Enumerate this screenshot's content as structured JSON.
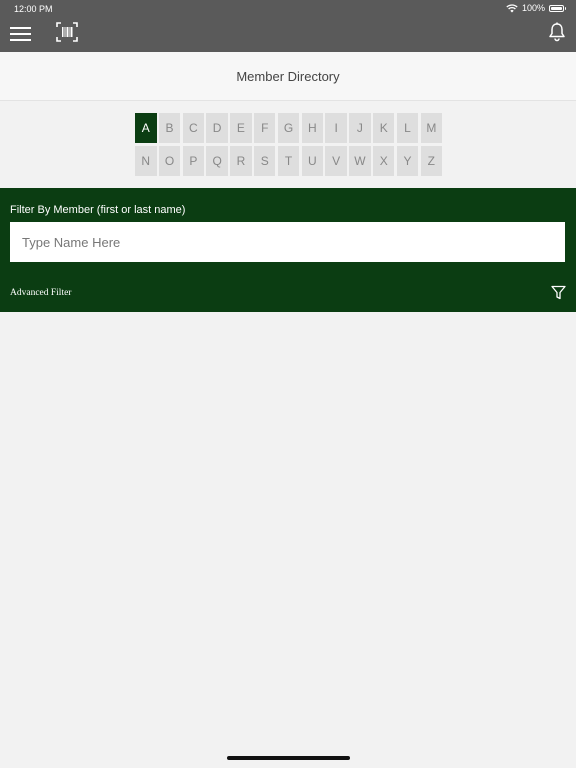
{
  "status": {
    "time": "12:00 PM",
    "battery": "100%",
    "battery_level": 1.0
  },
  "header": {
    "menu_icon": "hamburger-icon",
    "barcode_icon": "barcode-scan-icon",
    "bell_icon": "bell-icon"
  },
  "title": "Member Directory",
  "alphabet": {
    "selected": "A",
    "row1": [
      "A",
      "B",
      "C",
      "D",
      "E",
      "F",
      "G",
      "H",
      "I",
      "J",
      "K",
      "L",
      "M"
    ],
    "row2": [
      "N",
      "O",
      "P",
      "Q",
      "R",
      "S",
      "T",
      "U",
      "V",
      "W",
      "X",
      "Y",
      "Z"
    ]
  },
  "filter": {
    "label": "Filter By Member (first or last name)",
    "placeholder": "Type Name Here",
    "value": "",
    "advanced_label": "Advanced Filter",
    "filter_icon": "funnel-icon"
  },
  "colors": {
    "header": "#5a5a5a",
    "accent": "#0b3d12",
    "background": "#f2f2f2"
  }
}
